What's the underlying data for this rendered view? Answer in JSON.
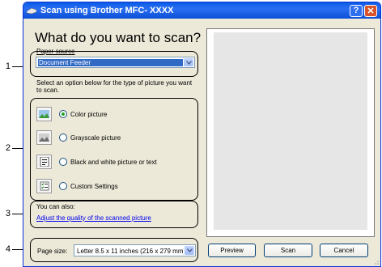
{
  "window": {
    "title": "Scan using Brother MFC- XXXX"
  },
  "heading": "What do you want to scan?",
  "paper_source": {
    "label": "Paper source",
    "value": "Document Feeder"
  },
  "instructions": "Select an option below for the type of picture you want to scan.",
  "options": [
    {
      "label": "Color picture",
      "selected": true,
      "icon": "color-picture-icon"
    },
    {
      "label": "Grayscale picture",
      "selected": false,
      "icon": "grayscale-picture-icon"
    },
    {
      "label": "Black and white picture or text",
      "selected": false,
      "icon": "black-white-text-icon"
    },
    {
      "label": "Custom Settings",
      "selected": false,
      "icon": "custom-settings-icon"
    }
  ],
  "also": {
    "label": "You can also:",
    "link": "Adjust the quality of the scanned picture"
  },
  "page_size": {
    "label": "Page size:",
    "value": "Letter 8.5 x 11 inches (216 x 279 mm)"
  },
  "buttons": {
    "preview": "Preview",
    "scan": "Scan",
    "cancel": "Cancel"
  },
  "callouts": [
    "1",
    "2",
    "3",
    "4"
  ],
  "colors": {
    "titlebar": "#0a5ce6",
    "selection": "#316ac5",
    "link": "#0000ee",
    "close": "#d9532a"
  }
}
